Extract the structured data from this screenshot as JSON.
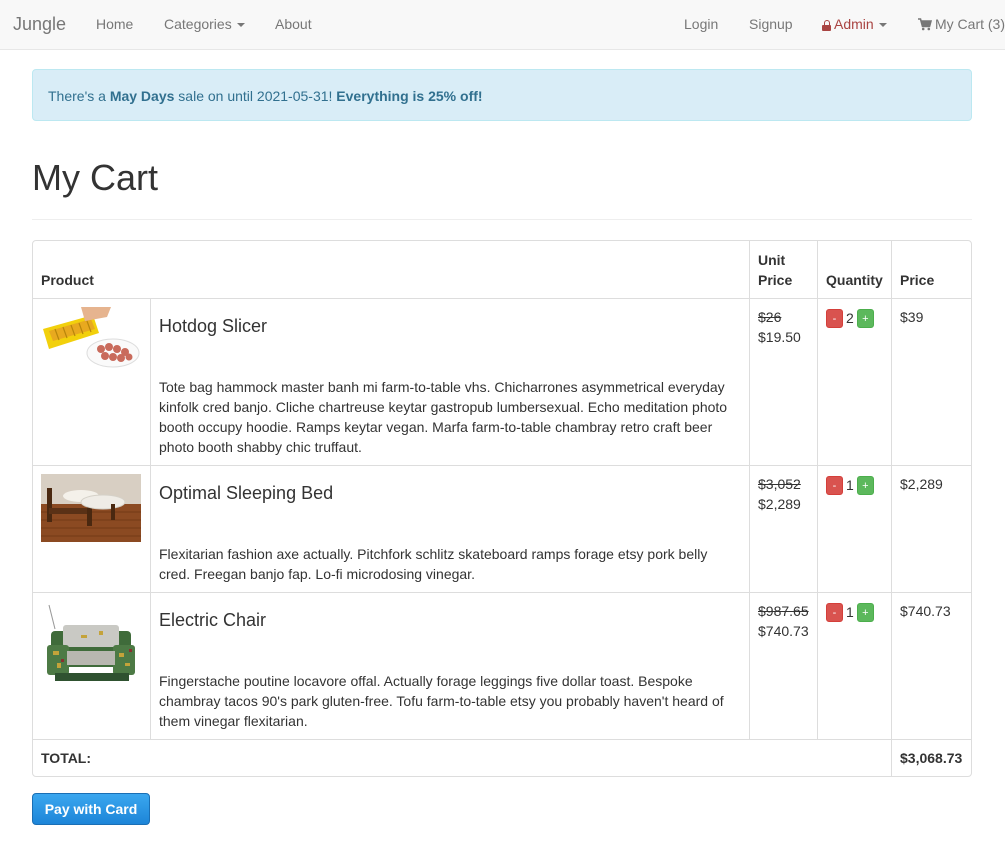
{
  "navbar": {
    "brand": "Jungle",
    "home": "Home",
    "categories": "Categories",
    "about": "About",
    "login": "Login",
    "signup": "Signup",
    "admin": "Admin",
    "cart": "My Cart (3)"
  },
  "alert": {
    "prefix": "There's a ",
    "sale_name": "May Days",
    "middle": " sale on until 2021-05-31! ",
    "highlight": "Everything is 25% off!"
  },
  "page_title": "My Cart",
  "table": {
    "headers": {
      "product": "Product",
      "unit_price": "Unit Price",
      "quantity": "Quantity",
      "price": "Price"
    },
    "items": [
      {
        "name": "Hotdog Slicer",
        "description": "Tote bag hammock master banh mi farm-to-table vhs. Chicharrones asymmetrical everyday kinfolk cred banjo. Cliche chartreuse keytar gastropub lumbersexual. Echo meditation photo booth occupy hoodie. Ramps keytar vegan. Marfa farm-to-table chambray retro craft beer photo booth shabby chic truffaut.",
        "old_price": "$26",
        "unit_price": "$19.50",
        "quantity": "2",
        "price": "$39"
      },
      {
        "name": "Optimal Sleeping Bed",
        "description": "Flexitarian fashion axe actually. Pitchfork schlitz skateboard ramps forage etsy pork belly cred. Freegan banjo fap. Lo-fi microdosing vinegar.",
        "old_price": "$3,052",
        "unit_price": "$2,289",
        "quantity": "1",
        "price": "$2,289"
      },
      {
        "name": "Electric Chair",
        "description": "Fingerstache poutine locavore offal. Actually forage leggings five dollar toast. Bespoke chambray tacos 90's park gluten-free. Tofu farm-to-table etsy you probably haven't heard of them vinegar flexitarian.",
        "old_price": "$987.65",
        "unit_price": "$740.73",
        "quantity": "1",
        "price": "$740.73"
      }
    ],
    "minus_label": "-",
    "plus_label": "+",
    "total_label": "TOTAL:",
    "total_value": "$3,068.73"
  },
  "pay_button": "Pay with Card",
  "colors": {
    "danger": "#d9534f",
    "success": "#5cb85c",
    "primary": "#1d85d8",
    "alert_bg": "#d9edf7"
  }
}
